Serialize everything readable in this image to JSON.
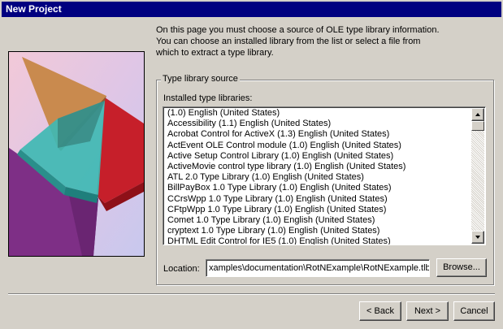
{
  "window": {
    "title": "New Project"
  },
  "intro": {
    "line1": "On this page you must choose a source of OLE type library information.",
    "line2": "You can choose an installed library from the list or select a file from",
    "line3": "which to extract a type library."
  },
  "group": {
    "legend": "Type library source",
    "list_label": "Installed type libraries:",
    "items": [
      "(1.0) English (United States)",
      "Accessibility (1.1) English (United States)",
      "Acrobat Control for ActiveX (1.3) English (United States)",
      "ActEvent OLE Control module (1.0) English (United States)",
      "Active Setup Control Library (1.0) English (United States)",
      "ActiveMovie control type library (1.0) English (United States)",
      "ATL 2.0 Type Library (1.0) English (United States)",
      "BillPayBox 1.0 Type Library (1.0) English (United States)",
      "CCrsWpp 1.0 Type Library (1.0) English (United States)",
      "CFtpWpp 1.0 Type Library (1.0) English (United States)",
      "Comet 1.0 Type Library (1.0) English (United States)",
      "cryptext 1.0 Type Library (1.0) English (United States)",
      "DHTML Edit Control for IE5 (1.0) English (United States)"
    ],
    "location_label": "Location:",
    "location_value": "xamples\\documentation\\RotNExample\\RotNExample.tlb",
    "browse_label": "Browse..."
  },
  "footer": {
    "back_label": "< Back",
    "next_label": "Next >",
    "cancel_label": "Cancel"
  },
  "colors": {
    "titlebar": "#000080",
    "face": "#d4d0c8"
  }
}
